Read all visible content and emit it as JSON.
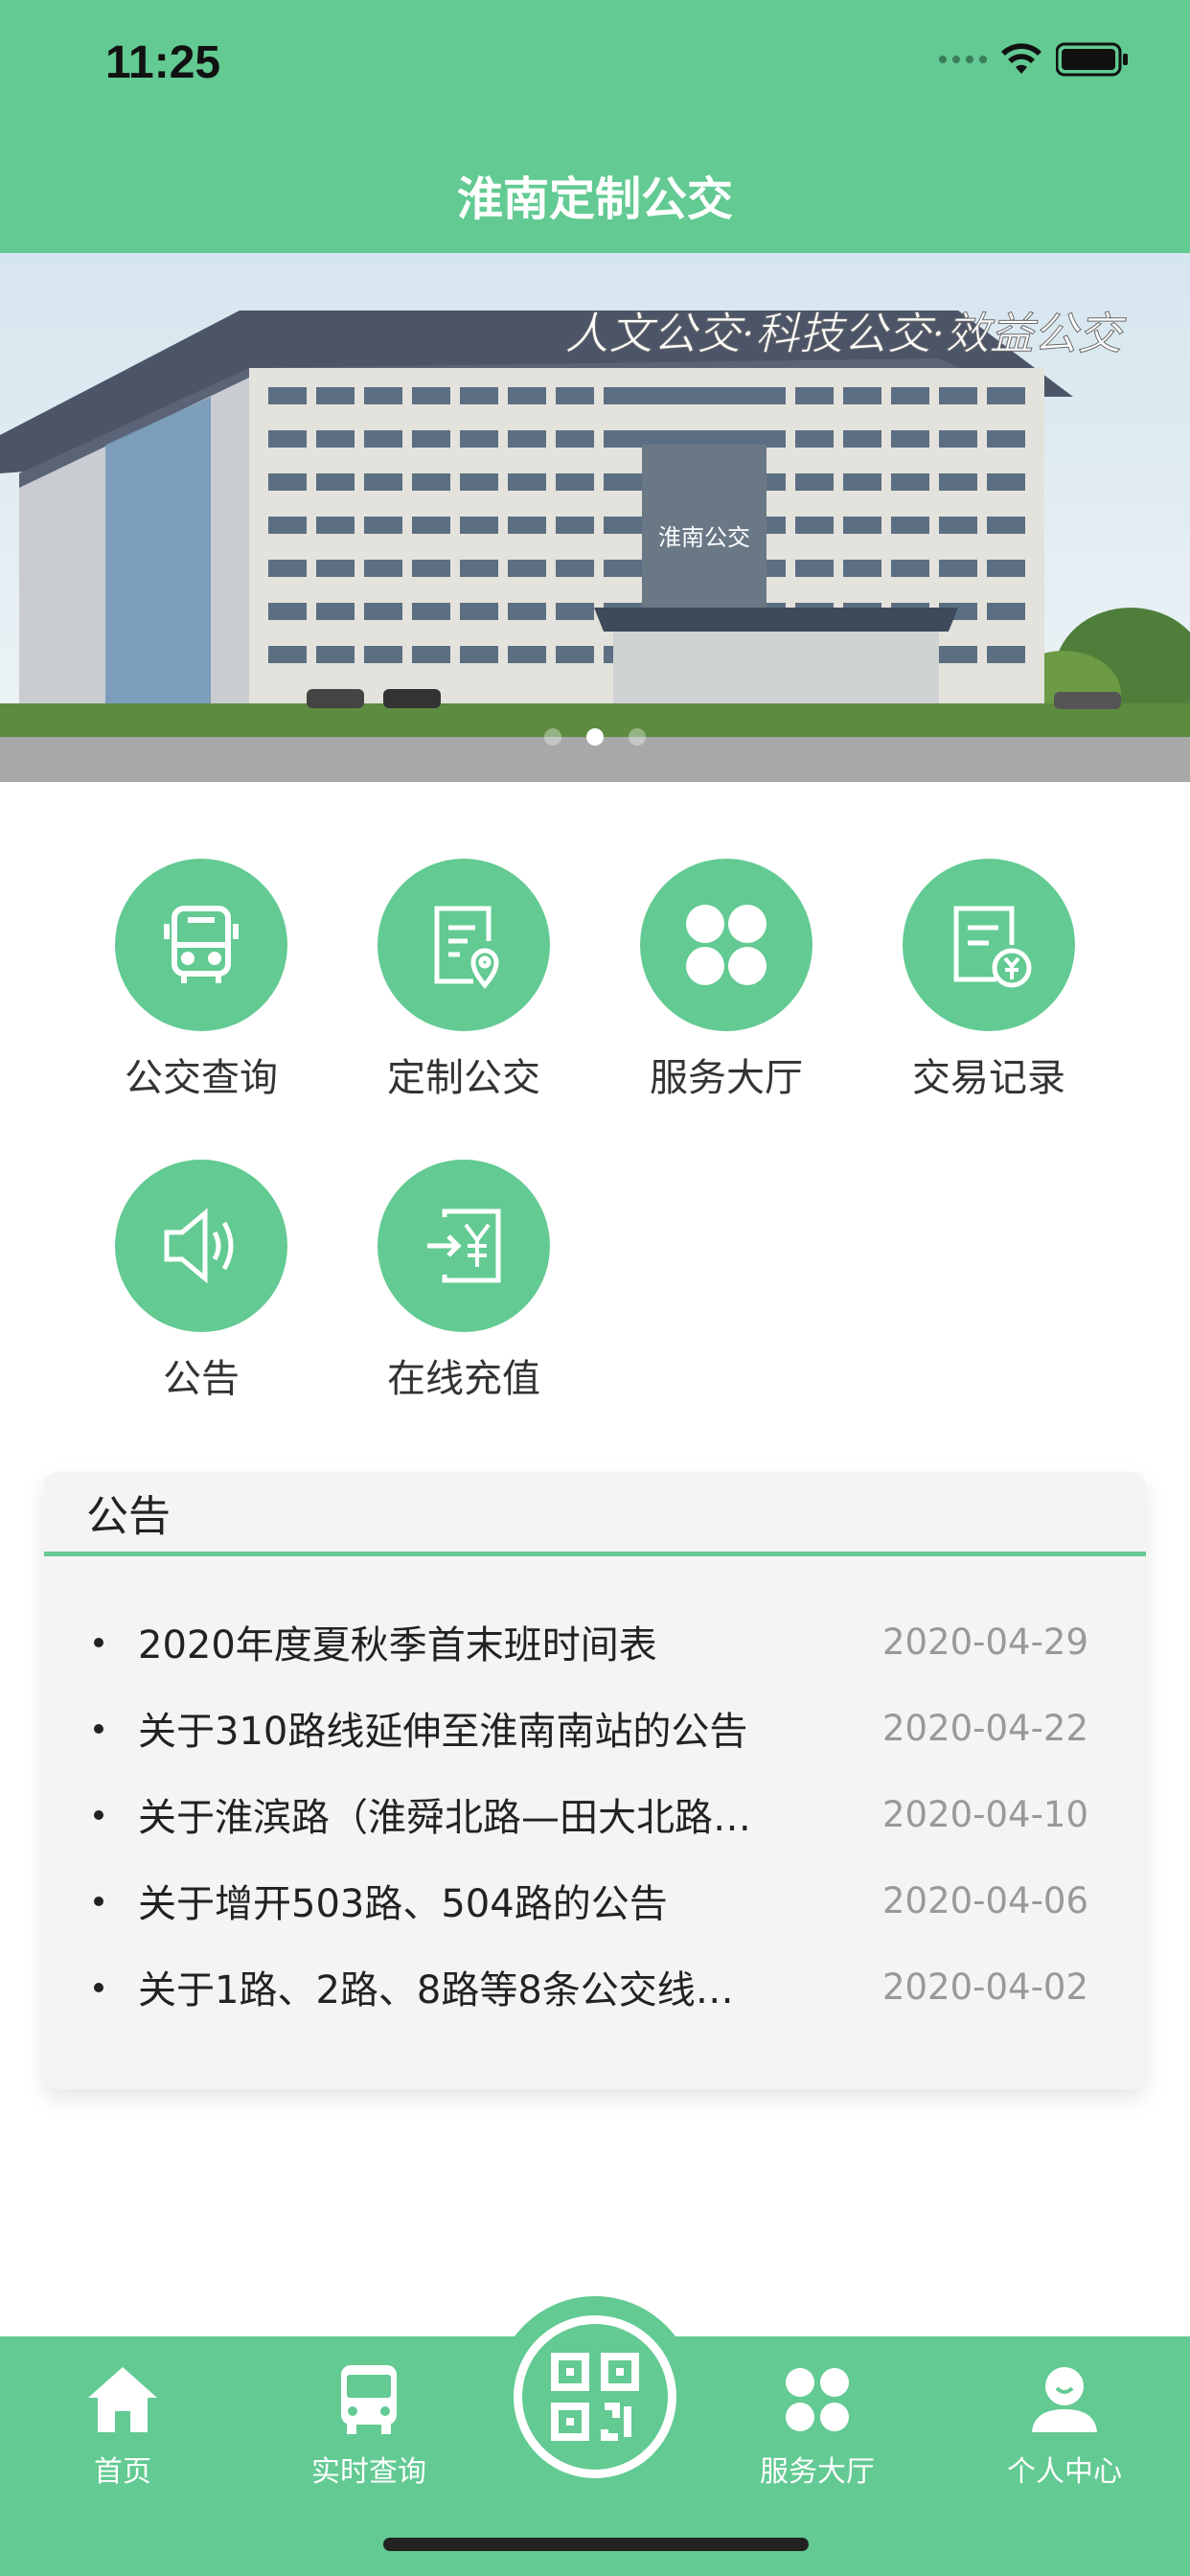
{
  "status_bar": {
    "time": "11:25"
  },
  "header": {
    "title": "淮南定制公交"
  },
  "banner": {
    "slogan": "人文公交·科技公交·效益公交",
    "building_sign": "淮南公交",
    "dots_total": 3,
    "active_dot": 2
  },
  "menu": [
    {
      "label": "公交查询",
      "icon": "bus-icon"
    },
    {
      "label": "定制公交",
      "icon": "document-location-icon"
    },
    {
      "label": "服务大厅",
      "icon": "four-dots-icon"
    },
    {
      "label": "交易记录",
      "icon": "receipt-yuan-icon"
    },
    {
      "label": "公告",
      "icon": "speaker-icon"
    },
    {
      "label": "在线充值",
      "icon": "recharge-yuan-icon"
    }
  ],
  "notice": {
    "heading": "公告",
    "items": [
      {
        "title": "2020年度夏秋季首末班时间表",
        "date": "2020-04-29"
      },
      {
        "title": "关于310路线延伸至淮南南站的公告",
        "date": "2020-04-22"
      },
      {
        "title": "关于淮滨路（淮舜北路—田大北路…",
        "date": "2020-04-10"
      },
      {
        "title": "关于增开503路、504路的公告",
        "date": "2020-04-06"
      },
      {
        "title": "关于1路、2路、8路等8条公交线…",
        "date": "2020-04-02"
      }
    ]
  },
  "tabbar": {
    "home": "首页",
    "realtime": "实时查询",
    "qr": "qr-code-icon",
    "service": "服务大厅",
    "profile": "个人中心"
  },
  "colors": {
    "accent": "#62ca92",
    "text": "#222222",
    "muted": "#999999"
  }
}
